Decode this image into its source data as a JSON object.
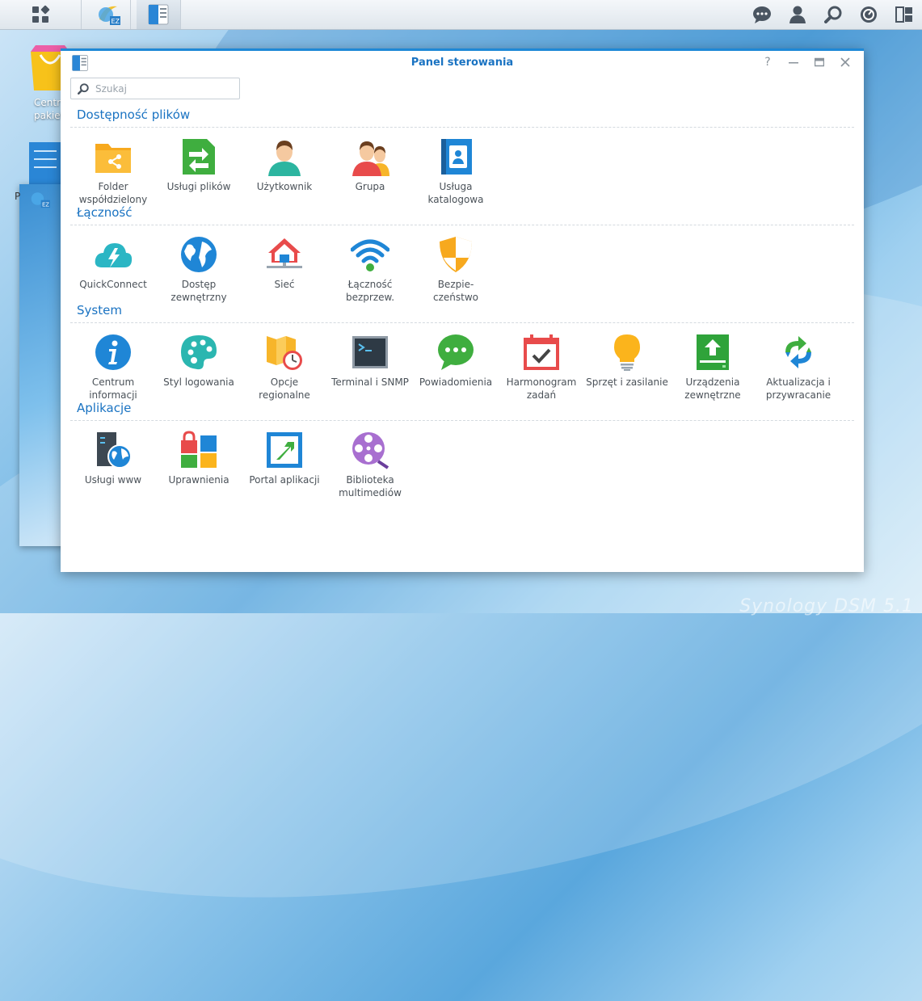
{
  "window": {
    "title": "Panel sterowania",
    "search_placeholder": "Szukaj",
    "help_label": "?"
  },
  "desktop": {
    "package_center_label_1": "Centr",
    "package_center_label_2": "pakiet",
    "partial_label": "P"
  },
  "sections": [
    {
      "title": "Dostępność plików",
      "items": [
        {
          "label": "Folder\nwspółdzielony",
          "icon": "shared-folder-icon"
        },
        {
          "label": "Usługi plików",
          "icon": "file-services-icon"
        },
        {
          "label": "Użytkownik",
          "icon": "user-icon"
        },
        {
          "label": "Grupa",
          "icon": "group-icon"
        },
        {
          "label": "Usługa\nkatalogowa",
          "icon": "directory-service-icon"
        }
      ]
    },
    {
      "title": "Łączność",
      "items": [
        {
          "label": "QuickConnect",
          "icon": "quickconnect-icon"
        },
        {
          "label": "Dostęp\nzewnętrzny",
          "icon": "external-access-icon"
        },
        {
          "label": "Sieć",
          "icon": "network-icon"
        },
        {
          "label": "Łączność\nbezprzew.",
          "icon": "wireless-icon"
        },
        {
          "label": "Bezpie-\nczeństwo",
          "icon": "security-icon"
        }
      ]
    },
    {
      "title": "System",
      "items": [
        {
          "label": "Centrum\ninformacji",
          "icon": "info-center-icon"
        },
        {
          "label": "Styl logowania",
          "icon": "login-style-icon"
        },
        {
          "label": "Opcje\nregionalne",
          "icon": "regional-options-icon"
        },
        {
          "label": "Terminal i SNMP",
          "icon": "terminal-icon"
        },
        {
          "label": "Powiadomienia",
          "icon": "notification-icon"
        },
        {
          "label": "Harmonogram\nzadań",
          "icon": "task-scheduler-icon"
        },
        {
          "label": "Sprzęt i zasilanie",
          "icon": "hardware-power-icon"
        },
        {
          "label": "Urządzenia\nzewnętrzne",
          "icon": "external-devices-icon"
        },
        {
          "label": "Aktualizacja i\nprzywracanie",
          "icon": "update-restore-icon"
        }
      ]
    },
    {
      "title": "Aplikacje",
      "items": [
        {
          "label": "Usługi www",
          "icon": "web-services-icon"
        },
        {
          "label": "Uprawnienia",
          "icon": "privileges-icon"
        },
        {
          "label": "Portal aplikacji",
          "icon": "application-portal-icon"
        },
        {
          "label": "Biblioteka\nmultimediów",
          "icon": "media-library-icon"
        }
      ]
    }
  ],
  "watermark": "Synology DSM 5.1",
  "colors": {
    "accent": "#1a73c2",
    "title_bar": "#1e88d6"
  }
}
